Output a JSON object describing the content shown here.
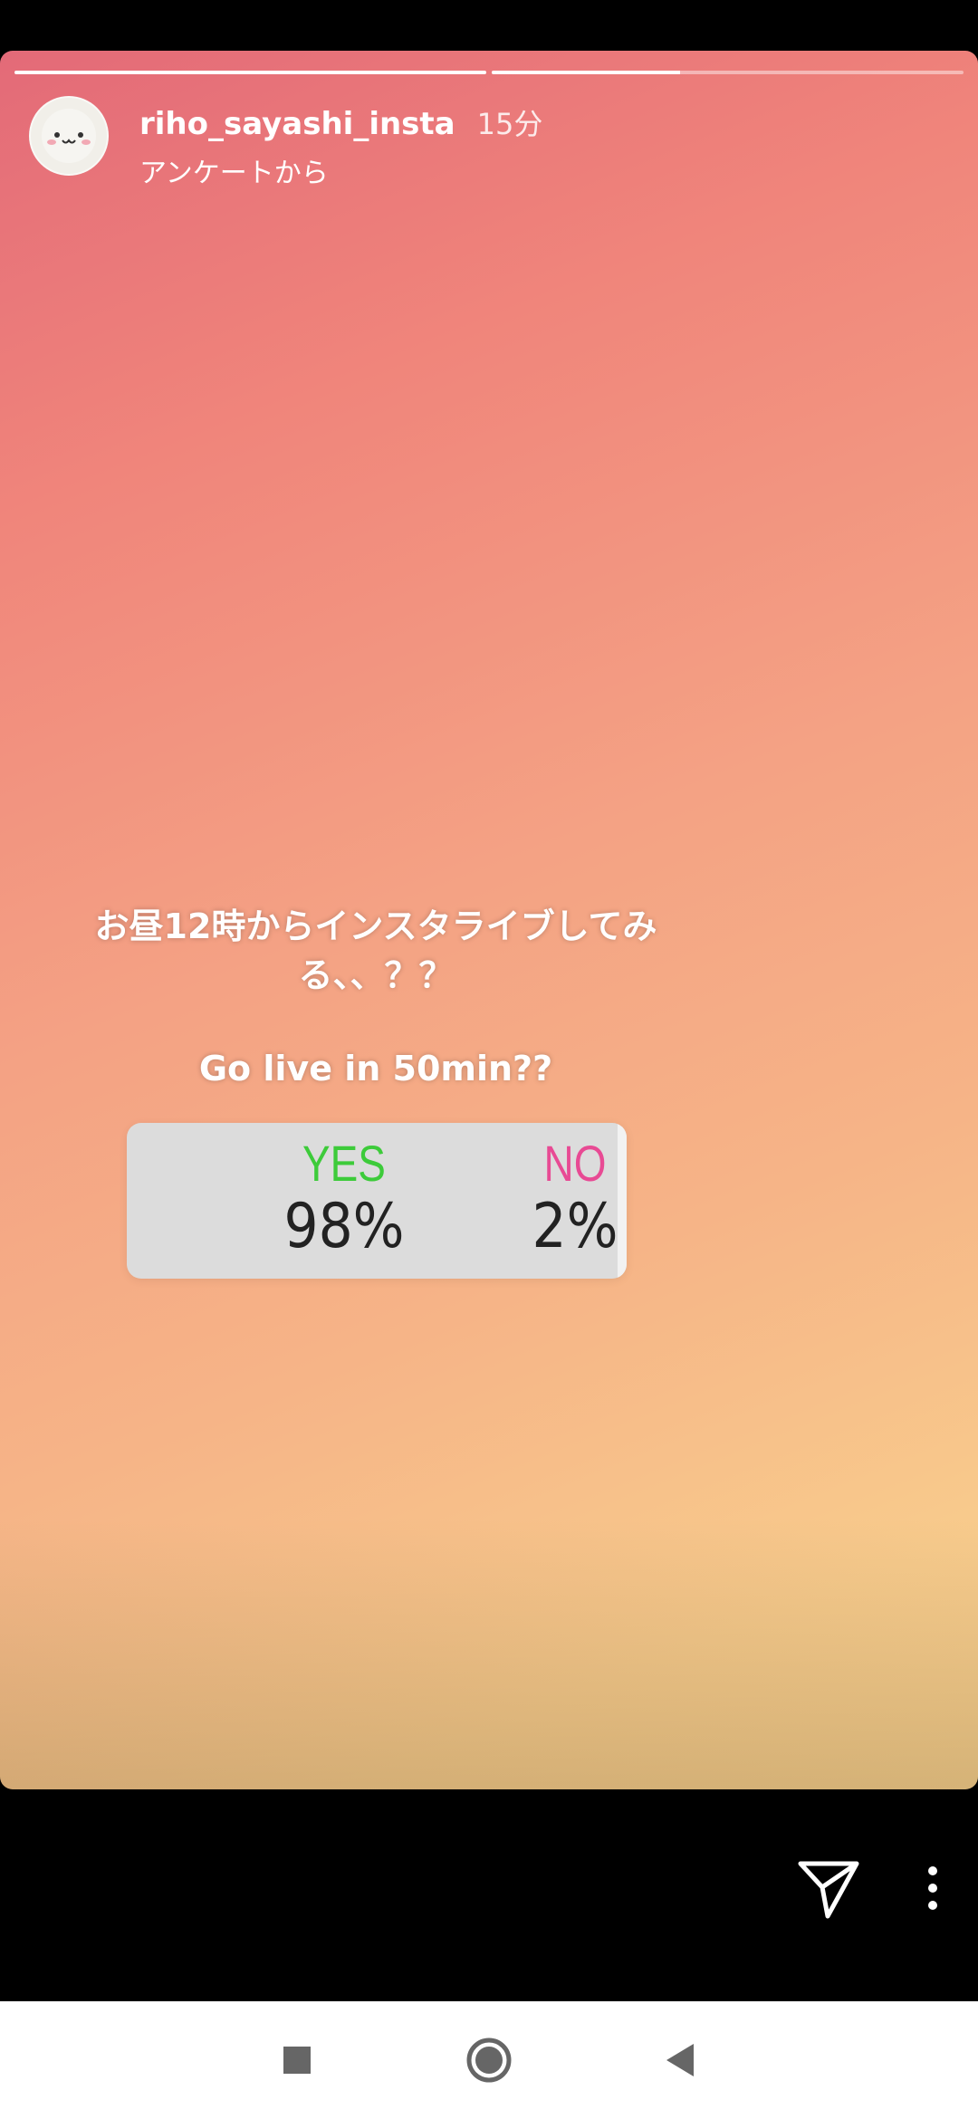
{
  "story": {
    "progress": [
      1.0,
      0.4
    ],
    "username": "riho_sayashi_insta",
    "time": "15分",
    "subtitle": "アンケートから",
    "caption_jp": "お昼12時からインスタライブしてみる、、？？",
    "caption_en": "Go live in 50min??"
  },
  "poll": {
    "yes_label": "YES",
    "yes_pct": "98%",
    "no_label": "NO",
    "no_pct": "2%",
    "colors": {
      "yes": "#3dcb3a",
      "no": "#e84a94"
    }
  },
  "actions": {
    "send_icon": "send-icon",
    "more_icon": "more-vertical-icon"
  },
  "navbar": {
    "recents_icon": "square-recents-icon",
    "home_icon": "circle-home-icon",
    "back_icon": "triangle-back-icon"
  }
}
